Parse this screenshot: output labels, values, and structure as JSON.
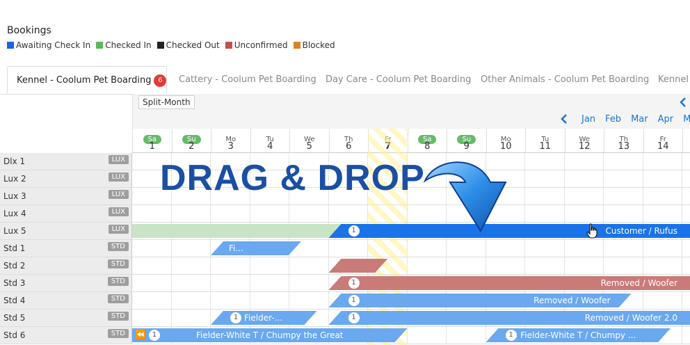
{
  "header": {
    "title": "Bookings"
  },
  "legend": [
    {
      "label": "Awaiting Check In",
      "color": "#1565e0"
    },
    {
      "label": "Checked In",
      "color": "#5cb85c"
    },
    {
      "label": "Checked Out",
      "color": "#222222"
    },
    {
      "label": "Unconfirmed",
      "color": "#c0504d"
    },
    {
      "label": "Blocked",
      "color": "#d9822b"
    }
  ],
  "tabs": [
    {
      "label": "Kennel - Coolum Pet Boarding",
      "badge": "6"
    },
    {
      "label": "Cattery - Coolum Pet Boarding"
    },
    {
      "label": "Day Care - Coolum Pet Boarding"
    },
    {
      "label": "Other Animals - Coolum Pet Boarding"
    },
    {
      "label": "Kennel"
    }
  ],
  "toolbar": {
    "split_label": "Split-Month",
    "prev_icon": "chevron-left-icon"
  },
  "months": {
    "prev_icon": "chevron-left-icon",
    "items": [
      "Jan",
      "Feb",
      "Mar",
      "Apr",
      "Ma"
    ]
  },
  "days": [
    {
      "name": "Sa",
      "num": "1",
      "weekend": true
    },
    {
      "name": "Su",
      "num": "2",
      "weekend": true
    },
    {
      "name": "Mo",
      "num": "3"
    },
    {
      "name": "Tu",
      "num": "4"
    },
    {
      "name": "We",
      "num": "5"
    },
    {
      "name": "Th",
      "num": "6"
    },
    {
      "name": "Fr",
      "num": "7",
      "today": true
    },
    {
      "name": "Sa",
      "num": "8",
      "weekend": true
    },
    {
      "name": "Su",
      "num": "9",
      "weekend": true
    },
    {
      "name": "Mo",
      "num": "10"
    },
    {
      "name": "Tu",
      "num": "11"
    },
    {
      "name": "We",
      "num": "12"
    },
    {
      "name": "Th",
      "num": "13"
    },
    {
      "name": "Fr",
      "num": "14"
    }
  ],
  "rooms": [
    {
      "name": "Dlx 1",
      "tag": "LUX"
    },
    {
      "name": "Lux 2",
      "tag": "LUX"
    },
    {
      "name": "Lux 3",
      "tag": "LUX"
    },
    {
      "name": "Lux 4",
      "tag": "LUX"
    },
    {
      "name": "Lux 5",
      "tag": "LUX"
    },
    {
      "name": "Std 1",
      "tag": "STD"
    },
    {
      "name": "Std 2",
      "tag": "STD"
    },
    {
      "name": "Std 3",
      "tag": "STD"
    },
    {
      "name": "Std 4",
      "tag": "STD"
    },
    {
      "name": "Std 5",
      "tag": "STD"
    },
    {
      "name": "Std 6",
      "tag": "STD"
    }
  ],
  "bookings": [
    {
      "row": 4,
      "startDay": 1,
      "endDay": 6.5,
      "status": "checked-in-faded",
      "label": "",
      "count": ""
    },
    {
      "row": 4,
      "startDay": 6,
      "endDay": 15,
      "status": "awaiting-strong",
      "label": "Customer / Rufus",
      "count": "1"
    },
    {
      "row": 5,
      "startDay": 3,
      "endDay": 4.8,
      "status": "awaiting",
      "label": "Fi...",
      "count": ""
    },
    {
      "row": 6,
      "startDay": 6,
      "endDay": 7,
      "status": "unconfirmed",
      "label": "",
      "count": ""
    },
    {
      "row": 7,
      "startDay": 6,
      "endDay": 15,
      "status": "unconfirmed",
      "label": "Removed / Woofer",
      "count": "1"
    },
    {
      "row": 8,
      "startDay": 6,
      "endDay": 13.2,
      "status": "awaiting",
      "label": "Removed / Woofer",
      "count": "1"
    },
    {
      "row": 9,
      "startDay": 3,
      "endDay": 5.2,
      "status": "awaiting",
      "label": "Fielder-...",
      "count": "1"
    },
    {
      "row": 9,
      "startDay": 6,
      "endDay": 15,
      "status": "awaiting",
      "label": "Removed / Woofer 2.0",
      "count": "1"
    },
    {
      "row": 10,
      "startDay": 1,
      "endDay": 7.5,
      "status": "awaiting",
      "label": "Fielder-White T / Chumpy the Great",
      "count": "1",
      "leftIcon": "double-chevron-left-icon"
    },
    {
      "row": 10,
      "startDay": 10,
      "endDay": 14.2,
      "status": "awaiting",
      "label": "Fielder-White T / Chumpy ...",
      "count": "1"
    }
  ],
  "overlay": {
    "headline": "DRAG & DROP",
    "arrow_icon": "curved-arrow-down-icon",
    "cursor_icon": "hand-cursor-icon"
  }
}
